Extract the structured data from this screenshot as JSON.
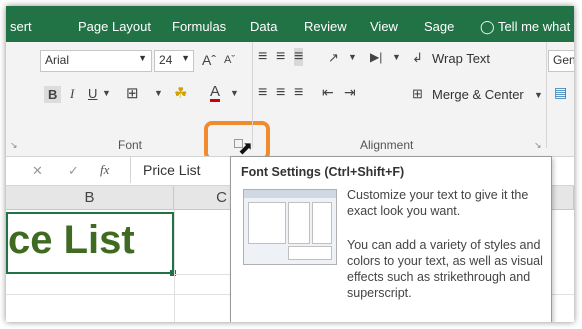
{
  "ribbon_tabs": [
    "sert",
    "Page Layout",
    "Formulas",
    "Data",
    "Review",
    "View",
    "Sage",
    "Tell me what y"
  ],
  "font": {
    "name": "Arial",
    "size": "24",
    "group_label": "Font"
  },
  "alignment": {
    "wrap_text": "Wrap Text",
    "merge_center": "Merge & Center",
    "group_label": "Alignment"
  },
  "number": {
    "format": "Gen"
  },
  "formula_bar": {
    "cancel": "✕",
    "enter": "✓",
    "fx": "fx",
    "value": "Price List"
  },
  "columns": [
    "B",
    "C"
  ],
  "cell": {
    "text": "ce List"
  },
  "tooltip": {
    "title": "Font Settings (Ctrl+Shift+F)",
    "para1": "Customize your text to give it the exact look you want.",
    "para2": "You can add a variety of styles and colors to your text, as well as visual effects such as strikethrough and superscript."
  },
  "colors": {
    "ribbon_green": "#217346",
    "highlight_orange": "#f08c2e",
    "cell_text": "#3e6b21"
  }
}
